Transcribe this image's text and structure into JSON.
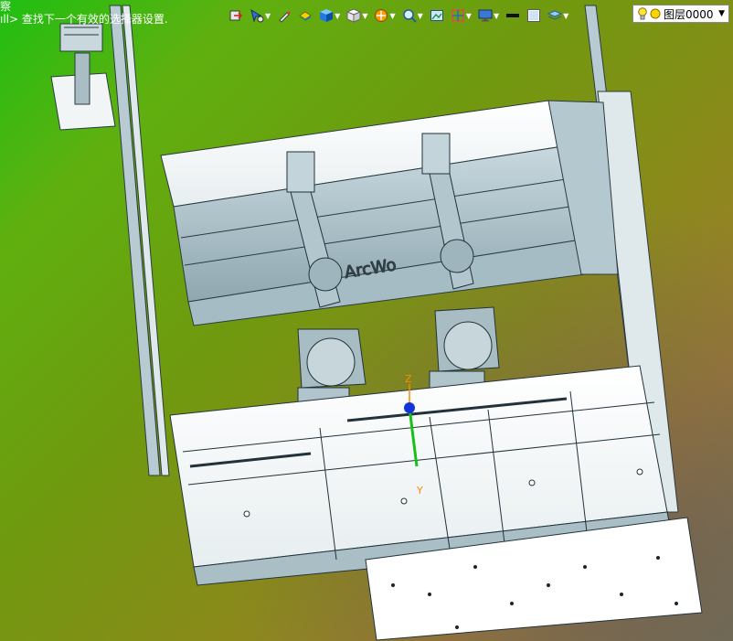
{
  "command_line": {
    "line1": "察",
    "line2": "ıll> 查找下一个有效的选择器设置."
  },
  "toolbar": {
    "tools": [
      {
        "icon": "coordinate-system-icon",
        "dd": false
      },
      {
        "icon": "select-filter-icon",
        "dd": true
      },
      {
        "icon": "sketch-pen-icon",
        "dd": false
      },
      {
        "icon": "display-style-icon",
        "dd": false
      },
      {
        "icon": "view-cube-icon",
        "dd": true
      },
      {
        "icon": "white-cube-icon",
        "dd": true
      },
      {
        "icon": "section-view-icon",
        "dd": true
      },
      {
        "icon": "zoom-icon",
        "dd": true
      },
      {
        "icon": "camera-icon",
        "dd": false
      },
      {
        "icon": "orientation-icon",
        "dd": true
      },
      {
        "icon": "monitor-icon",
        "dd": true
      },
      {
        "icon": "line-weight-icon",
        "dd": false
      },
      {
        "icon": "color-swatch-icon",
        "dd": false
      },
      {
        "icon": "layers-stack-icon",
        "dd": true
      }
    ],
    "colors": {
      "accent": "#2f6fd6",
      "warning": "#ff9900"
    }
  },
  "layer": {
    "current": "图层0000",
    "bulb_color": "#ffe23a",
    "sun_color": "#ffd400"
  },
  "model": {
    "gizmo_labels": {
      "x": "Z",
      "y": "Y"
    },
    "brand_text": "ArcWo"
  }
}
